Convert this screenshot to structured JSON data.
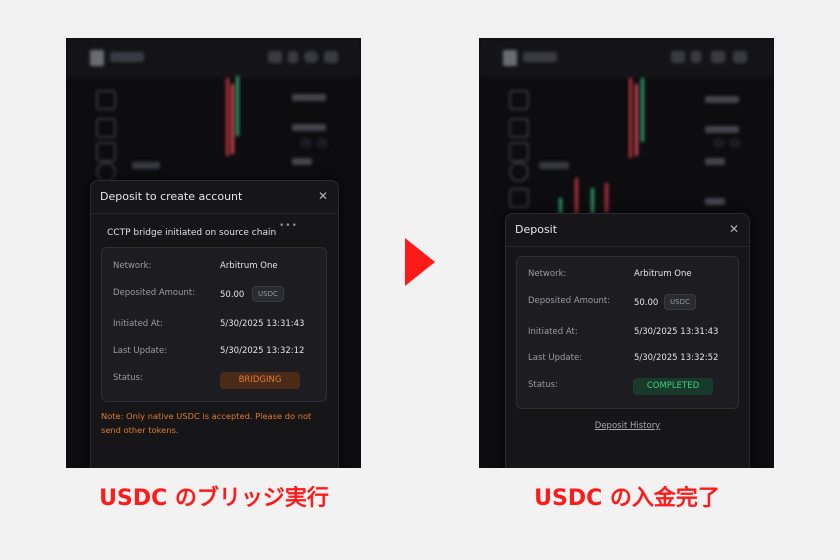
{
  "left": {
    "modal_title": "Deposit to create account",
    "bridge_status_text": "CCTP bridge initiated on source chain",
    "rows": {
      "network_label": "Network:",
      "network_value": "Arbitrum One",
      "amount_label": "Deposited Amount:",
      "amount_value": "50.00",
      "amount_unit": "USDC",
      "initiated_label": "Initiated At:",
      "initiated_value": "5/30/2025 13:31:43",
      "updated_label": "Last Update:",
      "updated_value": "5/30/2025 13:32:12",
      "status_label": "Status:",
      "status_value": "BRIDGING"
    },
    "note": "Note: Only native USDC is accepted. Please do not send other tokens.",
    "caption": "USDC のブリッジ実行"
  },
  "right": {
    "modal_title": "Deposit",
    "rows": {
      "network_label": "Network:",
      "network_value": "Arbitrum One",
      "amount_label": "Deposited Amount:",
      "amount_value": "50.00",
      "amount_unit": "USDC",
      "initiated_label": "Initiated At:",
      "initiated_value": "5/30/2025 13:31:43",
      "updated_label": "Last Update:",
      "updated_value": "5/30/2025 13:32:52",
      "status_label": "Status:",
      "status_value": "COMPLETED"
    },
    "history_link": "Deposit History",
    "caption": "USDC の入金完了"
  },
  "colors": {
    "accent_red": "#ff1a1a",
    "bridging_orange": "#e27a3b",
    "completed_green": "#3fcc82",
    "modal_bg": "#161619"
  },
  "icons": {
    "close": "close-icon",
    "loading": "dots-icon",
    "arrow": "arrow-right-icon"
  }
}
